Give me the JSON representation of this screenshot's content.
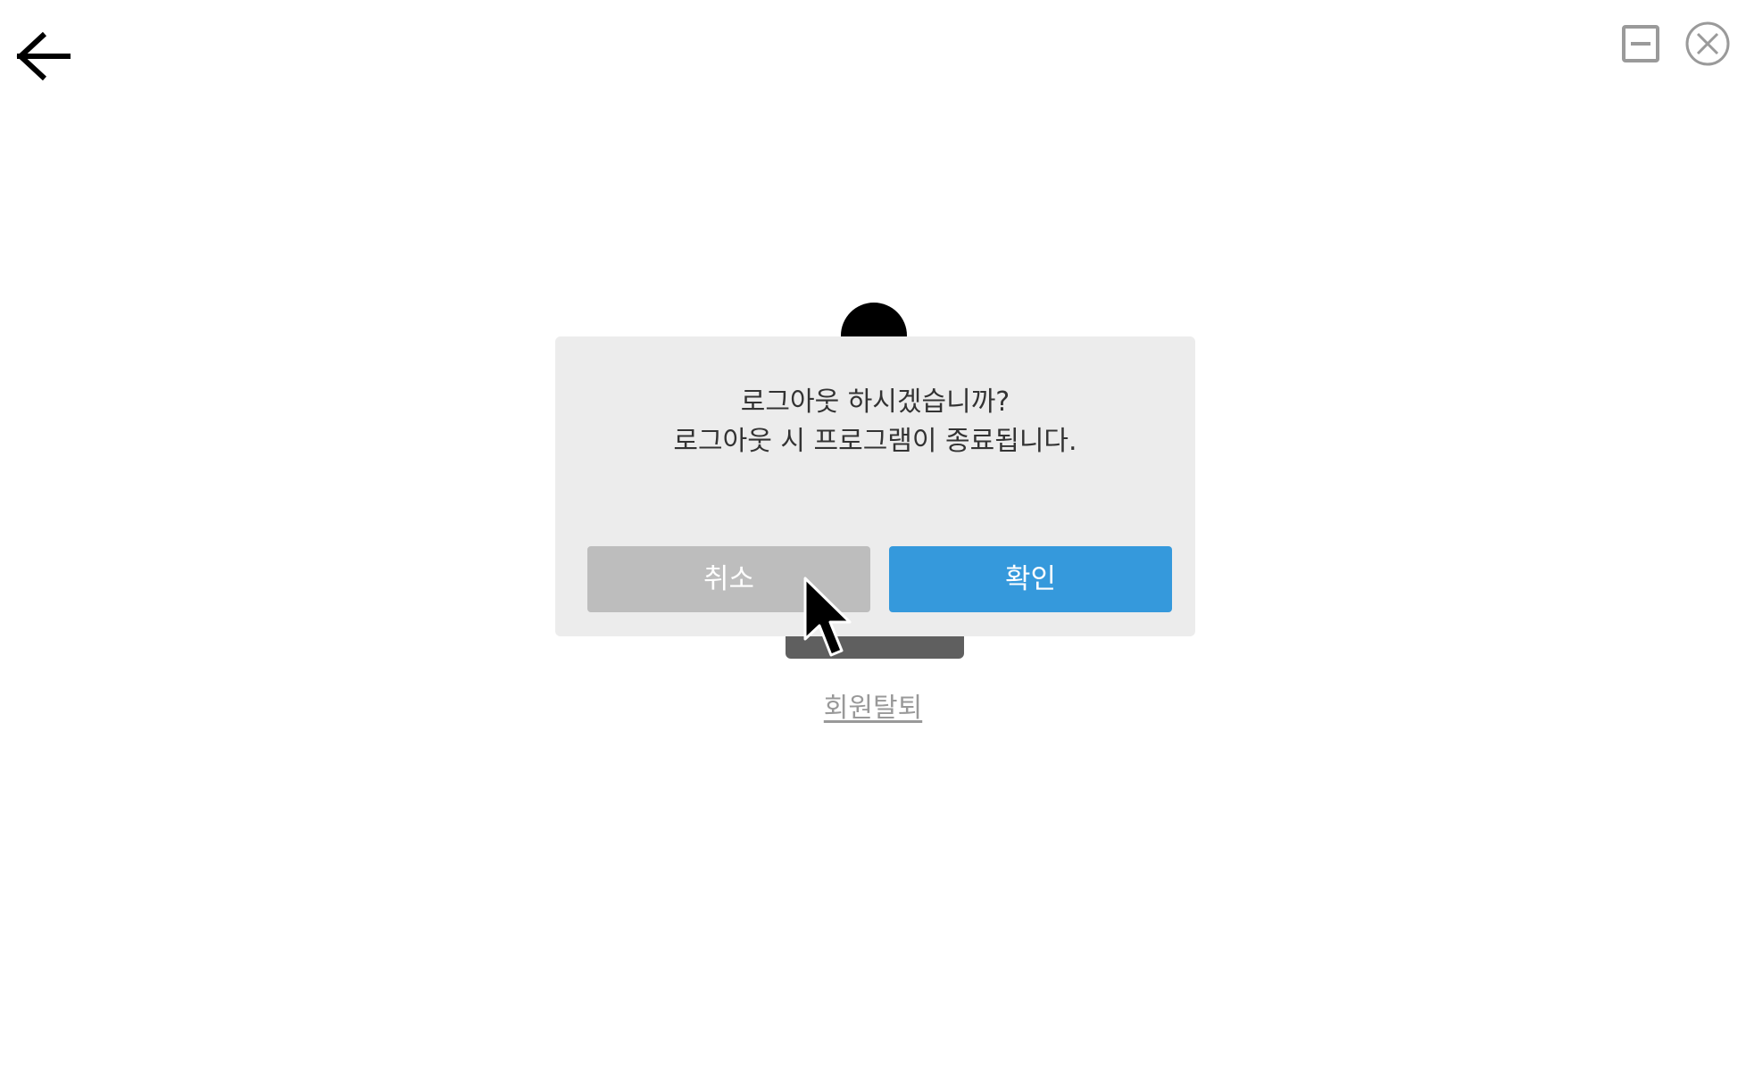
{
  "window": {
    "back_icon": "arrow-left-icon",
    "minimize_icon": "minimize-icon",
    "close_icon": "close-circle-icon"
  },
  "profile": {
    "avatar_icon": "avatar-icon",
    "withdraw_label": "회원탈퇴"
  },
  "dialog": {
    "message_line1": "로그아웃 하시겠습니까?",
    "message_line2": "로그아웃 시 프로그램이 종료됩니다.",
    "cancel_label": "취소",
    "confirm_label": "확인"
  },
  "colors": {
    "confirm": "#3599dc",
    "cancel": "#bdbdbd",
    "dialog_bg": "#ececec"
  }
}
